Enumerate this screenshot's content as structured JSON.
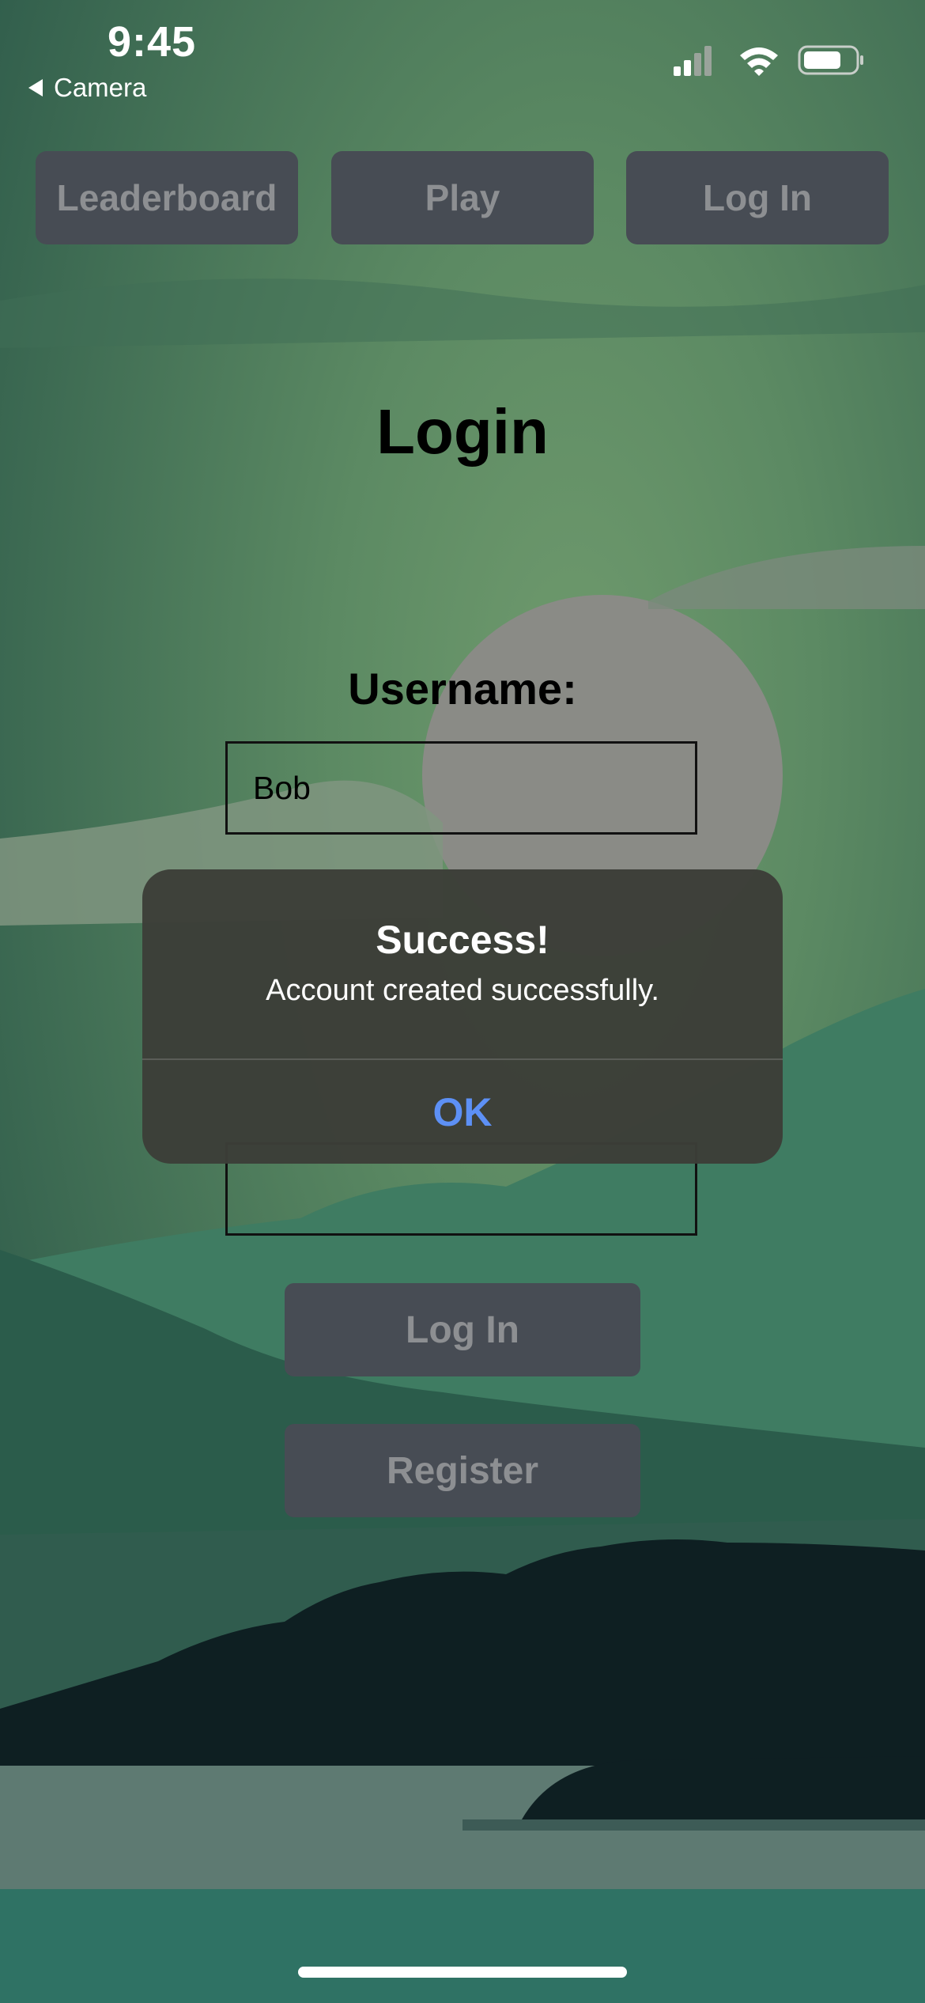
{
  "status_bar": {
    "time": "9:45",
    "back_label": "Camera",
    "icons": [
      "cellular-signal-icon",
      "wifi-icon",
      "battery-icon"
    ]
  },
  "nav": {
    "leaderboard": "Leaderboard",
    "play": "Play",
    "login": "Log In"
  },
  "page": {
    "title": "Login",
    "username_label": "Username:",
    "username_value": "Bob"
  },
  "actions": {
    "login": "Log In",
    "register": "Register"
  },
  "alert": {
    "title": "Success!",
    "message": "Account created successfully.",
    "ok": "OK"
  },
  "colors": {
    "button_bg": "#474c54",
    "button_text": "#8d8f92",
    "alert_bg": "#3c3e38",
    "alert_action": "#5d90f5"
  }
}
